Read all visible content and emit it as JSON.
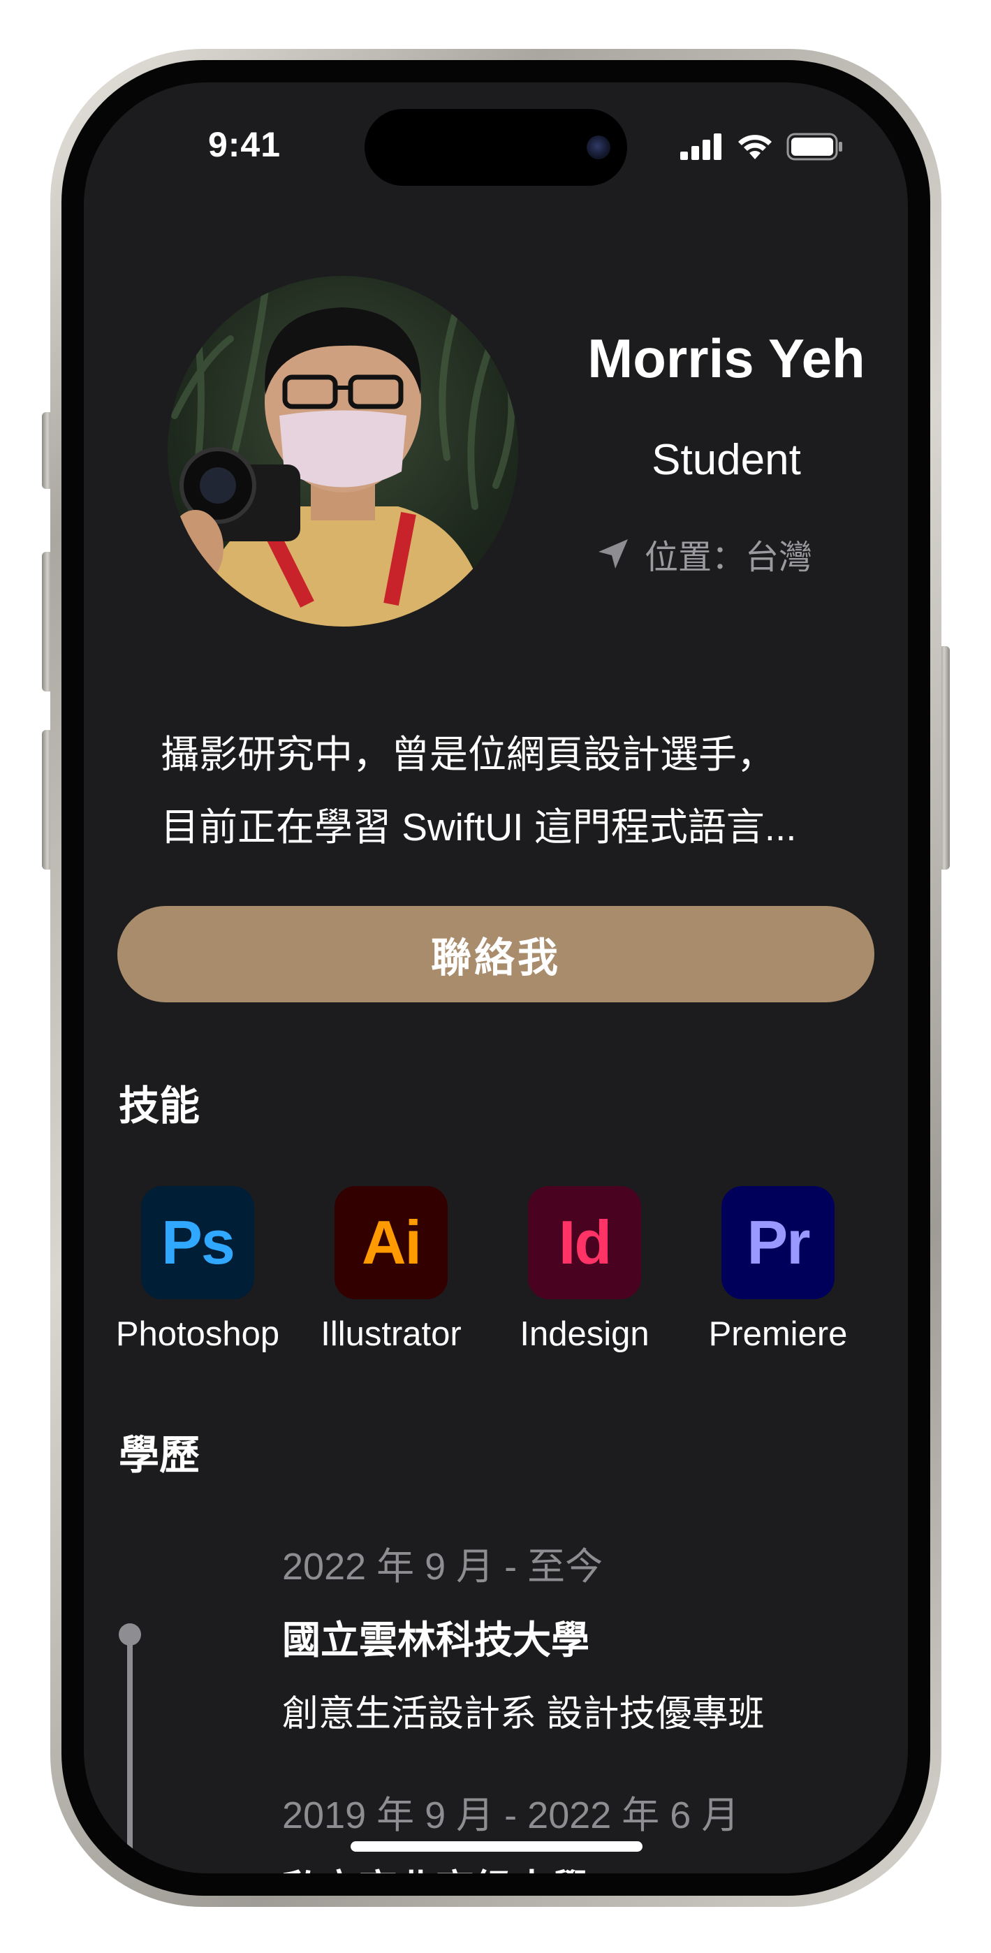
{
  "status_bar": {
    "time": "9:41"
  },
  "profile": {
    "name": "Morris Yeh",
    "role": "Student",
    "location": "位置：台灣",
    "bio_lines": [
      "攝影研究中，曾是位網頁設計選手，",
      "目前正在學習 SwiftUI 這門程式語言..."
    ]
  },
  "contact_button": {
    "label": "聯絡我"
  },
  "skills": {
    "title": "技能",
    "items": [
      {
        "abbr": "Ps",
        "label": "Photoshop",
        "tile_color": "#001e36",
        "text_color": "#31a8ff"
      },
      {
        "abbr": "Ai",
        "label": "Illustrator",
        "tile_color": "#330000",
        "text_color": "#ff9a00"
      },
      {
        "abbr": "Id",
        "label": "Indesign",
        "tile_color": "#49021f",
        "text_color": "#ff3366"
      },
      {
        "abbr": "Pr",
        "label": "Premiere",
        "tile_color": "#00005b",
        "text_color": "#9999ff"
      }
    ]
  },
  "education": {
    "title": "學歷",
    "items": [
      {
        "period": "2022 年 9 月 - 至今",
        "school": "國立雲林科技大學",
        "department": "創意生活設計系 設計技優專班"
      },
      {
        "period": "2019 年 9 月 - 2022 年 6 月",
        "school": "私立高北高級中學"
      }
    ]
  },
  "colors": {
    "screen_bg": "#1c1c1e",
    "accent": "#a88c6c",
    "secondary_text": "#8e8e92"
  }
}
